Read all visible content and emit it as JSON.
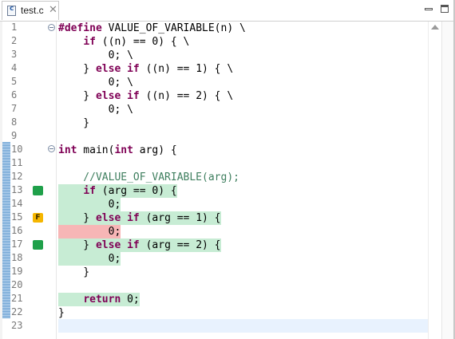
{
  "tab": {
    "title": "test.c",
    "close": "✕"
  },
  "lines": [
    {
      "n": "1",
      "code": "#define VALUE_OF_VARIABLE(n) \\"
    },
    {
      "n": "2",
      "code": "    if ((n) == 0) { \\"
    },
    {
      "n": "3",
      "code": "        0; \\"
    },
    {
      "n": "4",
      "code": "    } else if ((n) == 1) { \\"
    },
    {
      "n": "5",
      "code": "        0; \\"
    },
    {
      "n": "6",
      "code": "    } else if ((n) == 2) { \\"
    },
    {
      "n": "7",
      "code": "        0; \\"
    },
    {
      "n": "8",
      "code": "    }"
    },
    {
      "n": "9",
      "code": ""
    },
    {
      "n": "10",
      "code": "int main(int arg) {"
    },
    {
      "n": "11",
      "code": ""
    },
    {
      "n": "12",
      "code": "    //VALUE_OF_VARIABLE(arg);"
    },
    {
      "n": "13",
      "code": "    if (arg == 0) {"
    },
    {
      "n": "14",
      "code": "        0;"
    },
    {
      "n": "15",
      "code": "    } else if (arg == 1) {"
    },
    {
      "n": "16",
      "code": "        0;"
    },
    {
      "n": "17",
      "code": "    } else if (arg == 2) {"
    },
    {
      "n": "18",
      "code": "        0;"
    },
    {
      "n": "19",
      "code": "    }"
    },
    {
      "n": "20",
      "code": ""
    },
    {
      "n": "21",
      "code": "    return 0;"
    },
    {
      "n": "22",
      "code": "}"
    },
    {
      "n": "23",
      "code": ""
    }
  ],
  "markers": {
    "line13": "",
    "line15": "F",
    "line17": ""
  },
  "colors": {
    "covered": "#c7ecd4",
    "not_covered": "#f7b6b6",
    "keyword": "#7f0055",
    "comment": "#3f7f5f"
  }
}
